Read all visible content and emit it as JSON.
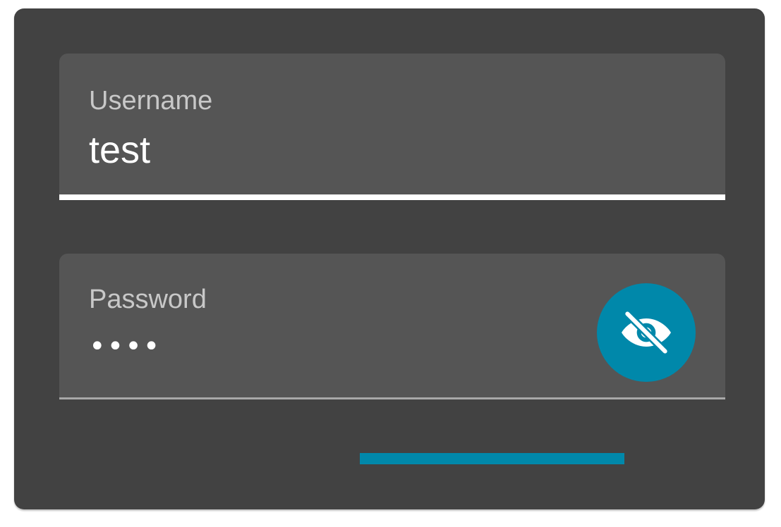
{
  "form": {
    "username": {
      "label": "Username",
      "value": "test"
    },
    "password": {
      "label": "Password",
      "masked_value": "••••",
      "visibility_toggle_icon": "eye-off-icon"
    },
    "submit_indicator": {
      "style": "bar"
    }
  },
  "colors": {
    "card_background": "#424242",
    "field_background": "#555555",
    "accent": "#0088aa",
    "label_text": "#c8c8c8",
    "value_text": "#ffffff"
  }
}
